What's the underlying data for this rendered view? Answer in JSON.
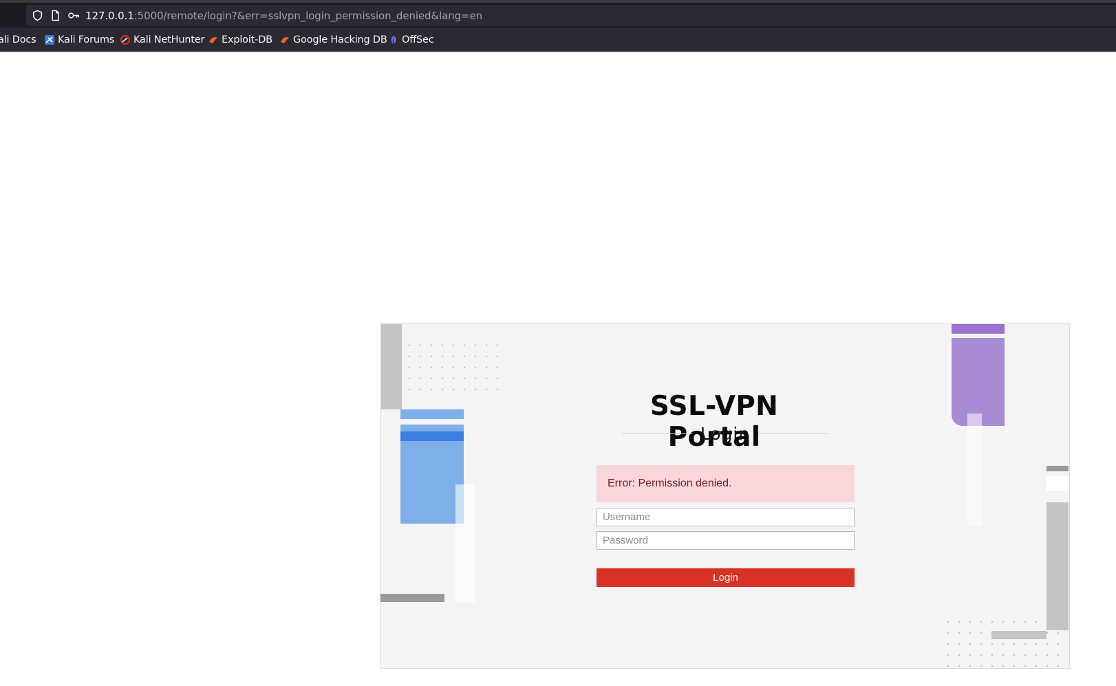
{
  "browser": {
    "url_host": "127.0.0.1",
    "url_rest": ":5000/remote/login?&err=sslvpn_login_permission_denied&lang=en",
    "bookmarks": [
      {
        "label": "ali Docs",
        "icon": "kali-docs-icon"
      },
      {
        "label": "Kali Forums",
        "icon": "kali-forums-icon"
      },
      {
        "label": "Kali NetHunter",
        "icon": "kali-nethunter-icon"
      },
      {
        "label": "Exploit-DB",
        "icon": "exploit-db-icon"
      },
      {
        "label": "Google Hacking DB",
        "icon": "google-hacking-db-icon"
      },
      {
        "label": "OffSec",
        "icon": "offsec-icon"
      }
    ]
  },
  "portal": {
    "title": "SSL-VPN Portal",
    "subtitle": "Login",
    "error_message": "Error: Permission denied.",
    "username_placeholder": "Username",
    "password_placeholder": "Password",
    "login_button_label": "Login"
  },
  "colors": {
    "accent_red": "#d93226",
    "error_bg": "#f8d7da",
    "error_text": "#721c24",
    "decor_blue": "#7eafe9",
    "decor_purple": "#a78bd4"
  }
}
